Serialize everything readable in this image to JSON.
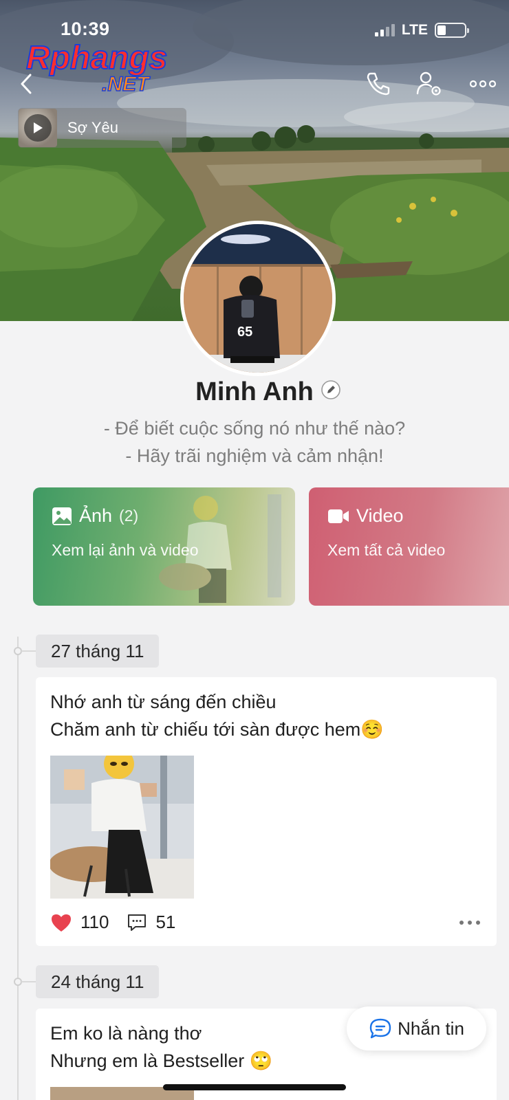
{
  "status_bar": {
    "time": "10:39",
    "network": "LTE"
  },
  "watermark": {
    "line1": "Rphangs",
    "line2": ".NET"
  },
  "header": {
    "back_icon": "chevron-left-icon",
    "actions": [
      "phone-icon",
      "user-settings-icon",
      "more-icon"
    ]
  },
  "music": {
    "title": "Sợ Yêu",
    "icon": "play-icon"
  },
  "profile": {
    "name": "Minh Anh",
    "bio_line1": "- Để biết cuộc sống nó như thế nào?",
    "bio_line2": "- Hãy trãi nghiệm và cảm nhận!"
  },
  "media_cards": {
    "photo": {
      "title": "Ảnh",
      "count": "(2)",
      "subtitle": "Xem lại ảnh và video",
      "color": "#3f9a63"
    },
    "video": {
      "title": "Video",
      "subtitle": "Xem tất cả video",
      "color": "#cf5f72"
    }
  },
  "timeline": [
    {
      "date": "27 tháng 11",
      "text_line1": "Nhớ anh từ sáng đến chiều",
      "text_line2": "Chăm anh từ chiếu tới sàn được hem☺️",
      "likes": "110",
      "comments": "51"
    },
    {
      "date": "24 tháng 11",
      "text_line1": "Em ko là nàng thơ",
      "text_line2": "Nhưng em là Bestseller 🙄"
    }
  ],
  "message_button": {
    "label": "Nhắn tin"
  },
  "colors": {
    "like": "#e8424f",
    "accent_blue": "#1a73e8"
  }
}
